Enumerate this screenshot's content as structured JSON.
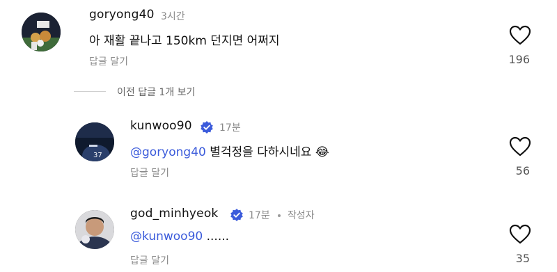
{
  "comments": [
    {
      "username": "goryong40",
      "time": "3시간",
      "text": "아 재활 끝나고 150km 던지면 어쩌지",
      "reply_label": "답글 달기",
      "likes": "196"
    }
  ],
  "previous_replies_label": "이전 답글 1개 보기",
  "replies": [
    {
      "username": "kunwoo90",
      "verified": true,
      "time": "17분",
      "mention": "@goryong40",
      "text": "별걱정을 다하시네요",
      "emoji": "😂",
      "reply_label": "답글 달기",
      "likes": "56"
    },
    {
      "username": "god_minhyeok",
      "verified": true,
      "time": "17분",
      "author_tag": "작성자",
      "mention": "@kunwoo90",
      "text": "......",
      "reply_label": "답글 달기",
      "likes": "35"
    }
  ],
  "colors": {
    "mention": "#3b5bdb",
    "verified": "#3b5bdb",
    "muted": "#8a8a8a"
  }
}
